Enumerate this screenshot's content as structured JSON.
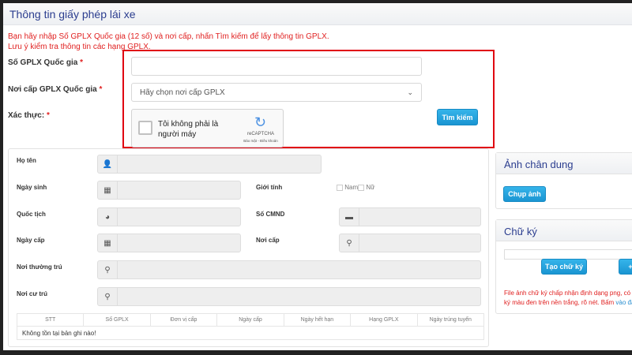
{
  "header": {
    "title": "Thông tin giấy phép lái xe"
  },
  "notice": {
    "line1": "Bạn hãy nhập Số GPLX Quốc gia (12 số) và nơi cấp, nhấn Tìm kiếm để lấy thông tin GPLX.",
    "line2": "Lưu ý kiểm tra thông tin các hạng GPLX."
  },
  "search": {
    "license_label": "Số GPLX Quốc gia",
    "license_value": "",
    "place_label": "Nơi cấp GPLX Quốc gia",
    "place_selected": "Hãy chọn nơi cấp GPLX",
    "verify_label": "Xác thực:",
    "required": "*",
    "captcha": {
      "text": "Tôi không phải là người máy",
      "brand": "reCAPTCHA",
      "links": "Bảo mật - Điều khoản"
    },
    "button": "Tìm kiếm"
  },
  "info": {
    "fields": {
      "name": "Họ tên",
      "dob": "Ngày sinh",
      "gender": "Giới tính",
      "male": "Nam",
      "female": "Nữ",
      "nationality": "Quốc tịch",
      "id": "Số CMND",
      "issue_date": "Ngày cấp",
      "issue_place": "Nơi cấp",
      "permanent": "Nơi thường trú",
      "residence": "Nơi cư trú"
    },
    "table": {
      "columns": [
        "STT",
        "Số GPLX",
        "Đơn vị cấp",
        "Ngày cấp",
        "Ngày hết hạn",
        "Hạng GPLX",
        "Ngày trúng tuyển"
      ],
      "empty": "Không tồn tại bản ghi nào!"
    }
  },
  "portrait": {
    "title": "Ảnh chân dung",
    "button": "Chụp ảnh"
  },
  "signature": {
    "title": "Chữ ký",
    "create_button": "Tạo chữ ký",
    "add_button": "+",
    "note1": "File ảnh chữ ký chấp nhận định dạng png, có d",
    "note2": "ký màu đen trên nền trắng, rõ nét. Bấm ",
    "link": "vào đây"
  }
}
